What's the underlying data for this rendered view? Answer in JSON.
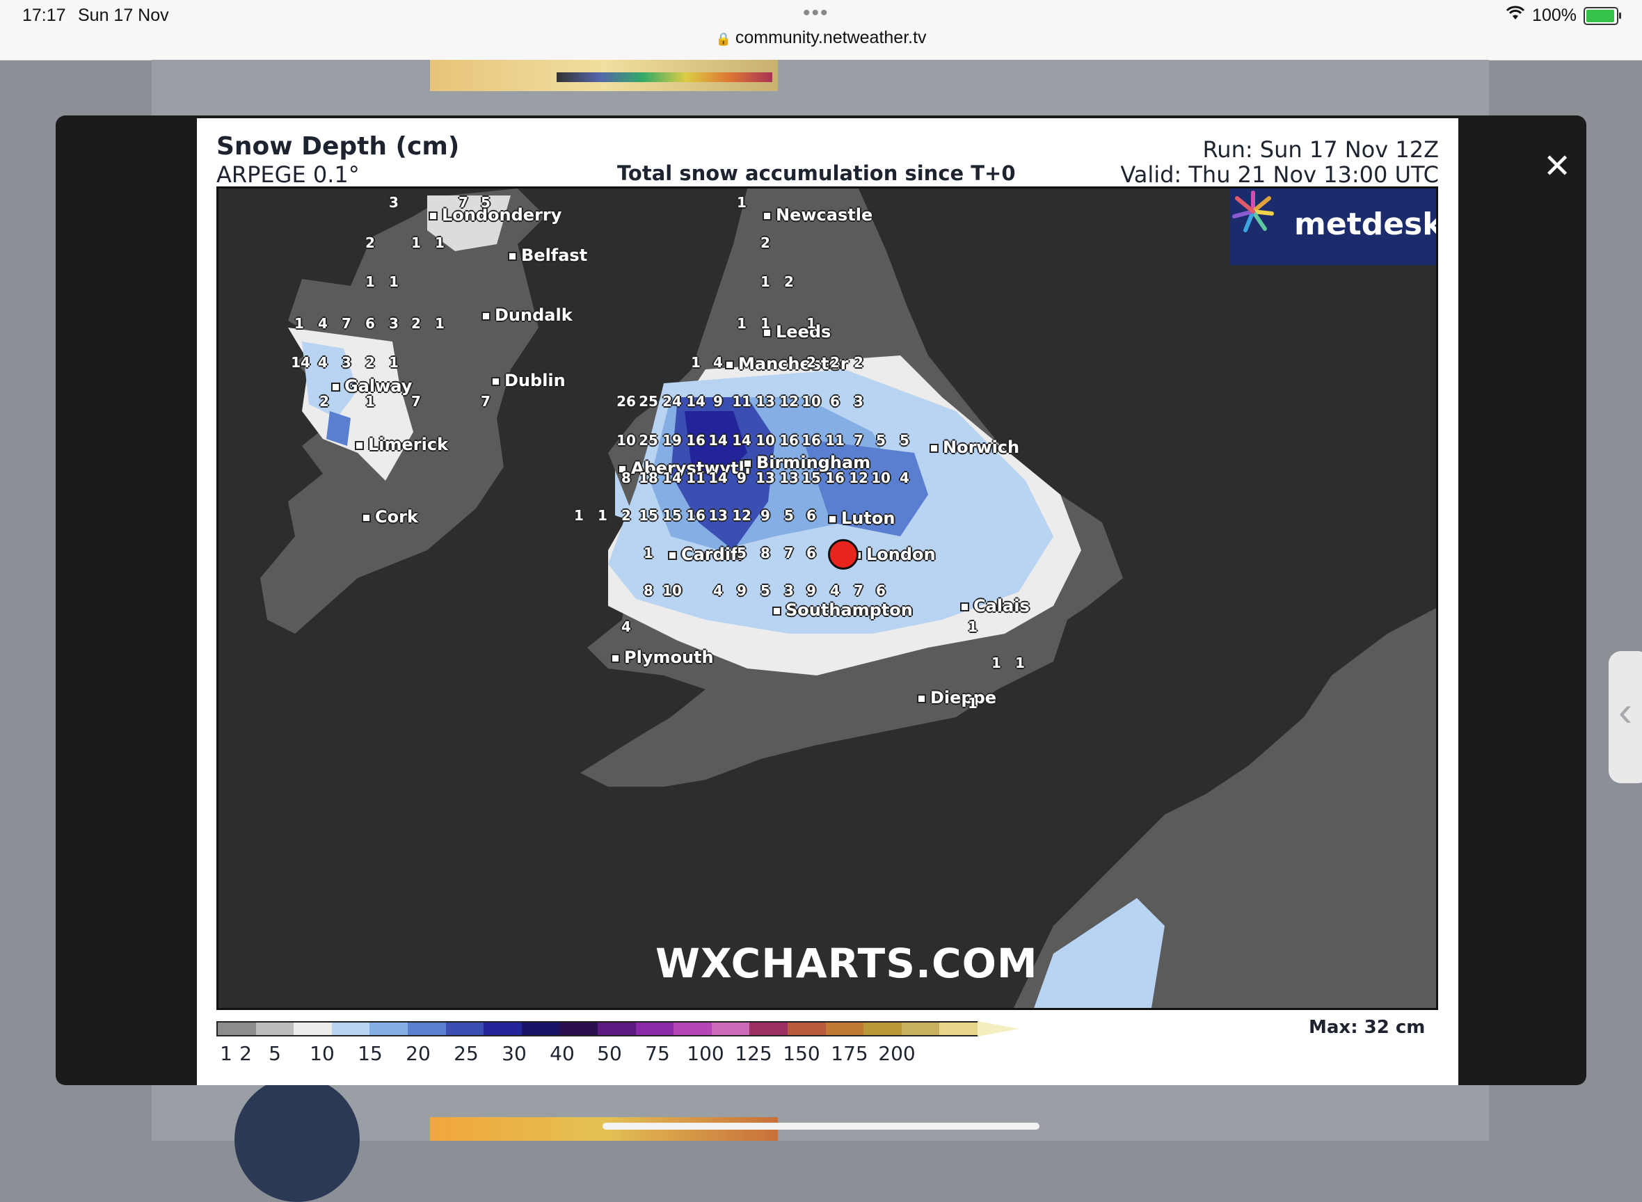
{
  "status": {
    "time": "17:17",
    "date": "Sun 17 Nov",
    "url": "community.netweather.tv",
    "battery": "100%"
  },
  "chart": {
    "title": "Snow Depth (cm)",
    "model": "ARPEGE 0.1°",
    "subtitle": "Total snow accumulation since T+0",
    "run": "Run: Sun 17 Nov 12Z",
    "valid": "Valid: Thu 21 Nov 13:00 UTC",
    "logo": "metdesk",
    "watermark": "WXCHARTS.COM",
    "max_label": "Max: 32 cm"
  },
  "legend": {
    "ticks": [
      "1",
      "2",
      "5",
      "10",
      "15",
      "20",
      "25",
      "30",
      "40",
      "50",
      "75",
      "100",
      "125",
      "150",
      "175",
      "200"
    ],
    "colors": [
      "#8c8c8c",
      "#bcbcbc",
      "#ececec",
      "#b8d4f2",
      "#84aee4",
      "#5a7fd0",
      "#3b4fb2",
      "#23239a",
      "#1a1468",
      "#2a1050",
      "#5a1a80",
      "#8a2aa8",
      "#b444b8",
      "#cc6ab8",
      "#9c2f62",
      "#b85a3c",
      "#c07a34",
      "#b89838",
      "#c9b060",
      "#e8d78a",
      "#f4eec0"
    ]
  },
  "map": {
    "cities": [
      {
        "name": "Londonderry"
      },
      {
        "name": "Belfast"
      },
      {
        "name": "Dundalk"
      },
      {
        "name": "Dublin"
      },
      {
        "name": "Galway"
      },
      {
        "name": "Limerick"
      },
      {
        "name": "Cork"
      },
      {
        "name": "Newcastle"
      },
      {
        "name": "Leeds"
      },
      {
        "name": "Manchester"
      },
      {
        "name": "Aberystwyth"
      },
      {
        "name": "Birmingham"
      },
      {
        "name": "Norwich"
      },
      {
        "name": "Luton"
      },
      {
        "name": "Cardiff"
      },
      {
        "name": "London"
      },
      {
        "name": "Southampton"
      },
      {
        "name": "Plymouth"
      },
      {
        "name": "Calais"
      },
      {
        "name": "Dieppe"
      }
    ],
    "values": [
      "3",
      "7",
      "5",
      "2",
      "1",
      "1",
      "1",
      "1",
      "1",
      "4",
      "7",
      "6",
      "3",
      "2",
      "1",
      "14",
      "4",
      "3",
      "2",
      "1",
      "2",
      "1",
      "7",
      "7",
      "1",
      "2",
      "1",
      "2",
      "1",
      "1",
      "1",
      "4",
      "2",
      "2",
      "2",
      "1",
      "26",
      "25",
      "24",
      "14",
      "9",
      "11",
      "13",
      "12",
      "10",
      "6",
      "3",
      "10",
      "25",
      "19",
      "16",
      "14",
      "14",
      "10",
      "16",
      "16",
      "11",
      "7",
      "5",
      "5",
      "8",
      "18",
      "14",
      "11",
      "14",
      "9",
      "13",
      "13",
      "15",
      "16",
      "12",
      "10",
      "4",
      "1",
      "1",
      "2",
      "15",
      "15",
      "16",
      "13",
      "12",
      "9",
      "5",
      "6",
      "1",
      "5",
      "8",
      "7",
      "6",
      "8",
      "10",
      "4",
      "9",
      "5",
      "3",
      "9",
      "4",
      "7",
      "6",
      "4",
      "1",
      "1",
      "1",
      "1"
    ]
  }
}
